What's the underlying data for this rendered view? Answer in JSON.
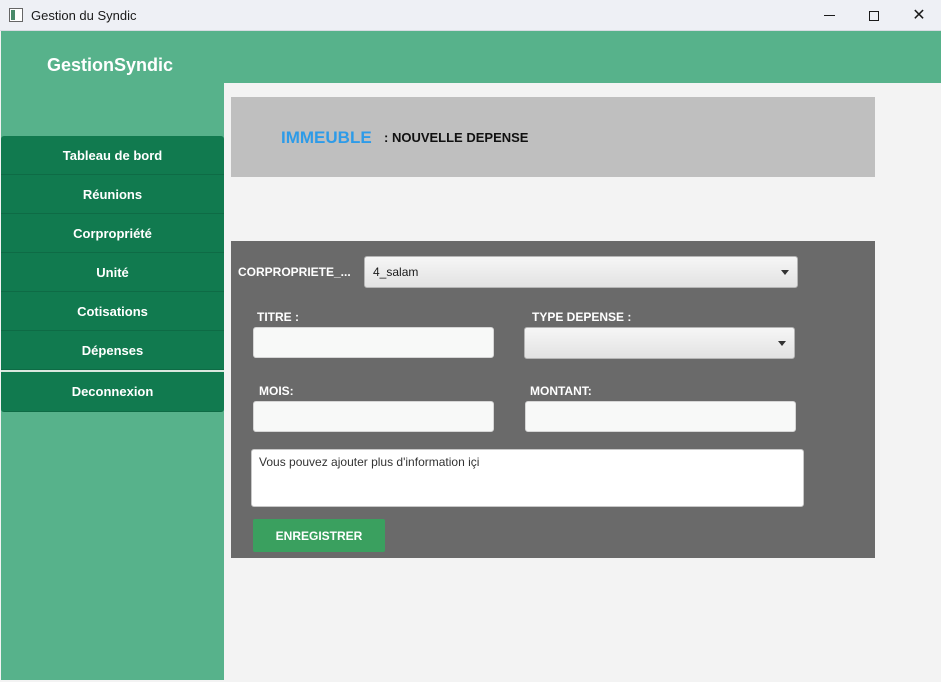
{
  "window": {
    "title": "Gestion du Syndic",
    "controls": {
      "minimize": "minimize-icon",
      "maximize": "maximize-icon",
      "close": "✕"
    }
  },
  "header": {
    "brand": "GestionSyndic"
  },
  "colors": {
    "header_green": "#57b28b",
    "menu_green": "#117a4f",
    "title_blue": "#2d9be8",
    "panel_gray": "#6a6a6a",
    "button_green": "#3aa05f"
  },
  "sidebar": {
    "items": [
      {
        "label": "Tableau de bord"
      },
      {
        "label": "Réunions"
      },
      {
        "label": "Corpropriété"
      },
      {
        "label": "Unité"
      },
      {
        "label": "Cotisations"
      },
      {
        "label": "Dépenses"
      }
    ],
    "logout_label": "Deconnexion"
  },
  "page": {
    "title": "IMMEUBLE",
    "subtitle": ": NOUVELLE DEPENSE"
  },
  "form": {
    "corpropriete": {
      "label": "CORPROPRIETE_...",
      "value": "4_salam"
    },
    "titre": {
      "label": "TITRE :",
      "value": ""
    },
    "type_depense": {
      "label": "TYPE DEPENSE :",
      "value": ""
    },
    "mois": {
      "label": "MOIS:",
      "value": ""
    },
    "montant": {
      "label": "MONTANT:",
      "value": ""
    },
    "notes": {
      "value": "Vous pouvez ajouter plus d'information içi"
    },
    "submit_label": "ENREGISTRER"
  }
}
